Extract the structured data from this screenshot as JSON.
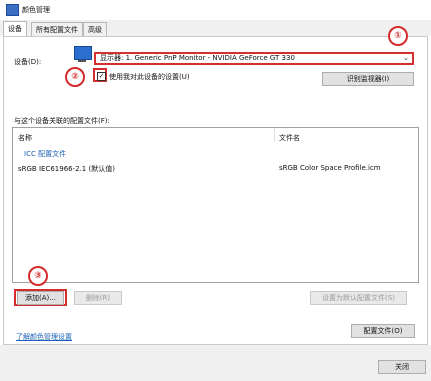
{
  "window": {
    "title": "颜色管理"
  },
  "tabs": [
    "设备",
    "所有配置文件",
    "高级"
  ],
  "device": {
    "label": "设备(D):",
    "selected": "显示器: 1. Generic PnP Monitor - NVIDIA GeForce GT 330",
    "use_settings_label": "使用我对此设备的设置(U)",
    "use_settings_checked": true,
    "identify_button": "识别监视器(I)"
  },
  "profiles": {
    "section_label": "与这个设备关联的配置文件(F):",
    "columns": [
      "名称",
      "文件名"
    ],
    "group_label": "ICC 配置文件",
    "rows": [
      {
        "name": "sRGB IEC61966-2.1 (默认值)",
        "file": "sRGB Color Space Profile.icm"
      }
    ]
  },
  "buttons": {
    "add": "添加(A)...",
    "remove": "删除(R)",
    "set_default": "设置为默认配置文件(S)",
    "profiles": "配置文件(O)",
    "close": "关闭"
  },
  "link": {
    "learn_more": "了解颜色管理设置"
  },
  "annotations": {
    "badge1": "①",
    "badge2": "②",
    "badge3": "③"
  },
  "colors": {
    "highlight": "#d42b2b",
    "link": "#1a5fb4"
  }
}
